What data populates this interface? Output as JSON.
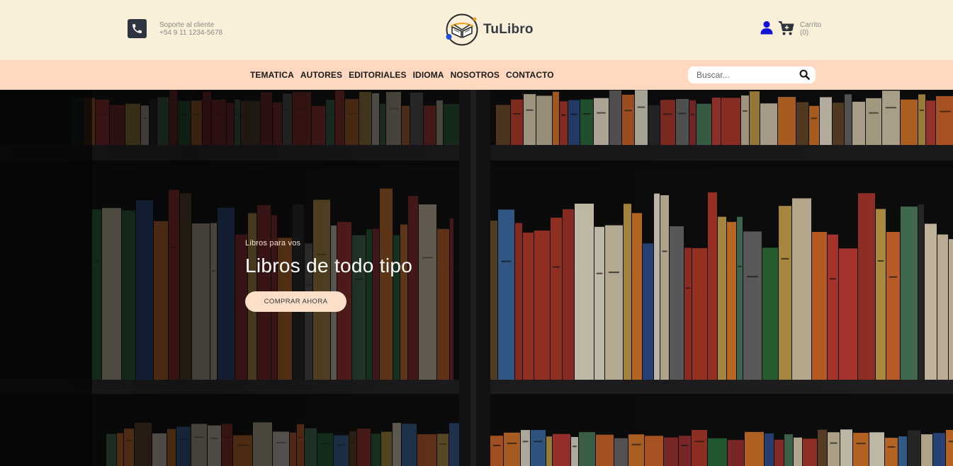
{
  "header": {
    "support_label": "Soporte al cliente",
    "support_phone": "+54 9 11 1234-5678",
    "brand_name": "TuLibro",
    "cart_label": "Carrito",
    "cart_count": "(0)",
    "icons": [
      "phone-icon",
      "book-logo-icon",
      "user-icon",
      "cart-icon"
    ]
  },
  "nav": {
    "items": [
      {
        "label": "TEMATICA"
      },
      {
        "label": "AUTORES"
      },
      {
        "label": "EDITORIALES"
      },
      {
        "label": "IDIOMA"
      },
      {
        "label": "NOSOTROS"
      },
      {
        "label": "CONTACTO"
      }
    ],
    "search_placeholder": "Buscar..."
  },
  "hero": {
    "eyebrow": "Libros para vos",
    "title": "Libros de todo tipo",
    "cta_label": "COMPRAR AHORA"
  },
  "colors": {
    "header_bg": "#faefd9",
    "nav_bg": "#ffd8bf",
    "cta_bg": "#fbdfc9",
    "user_icon": "#1313d4",
    "dark": "#2e3540"
  }
}
